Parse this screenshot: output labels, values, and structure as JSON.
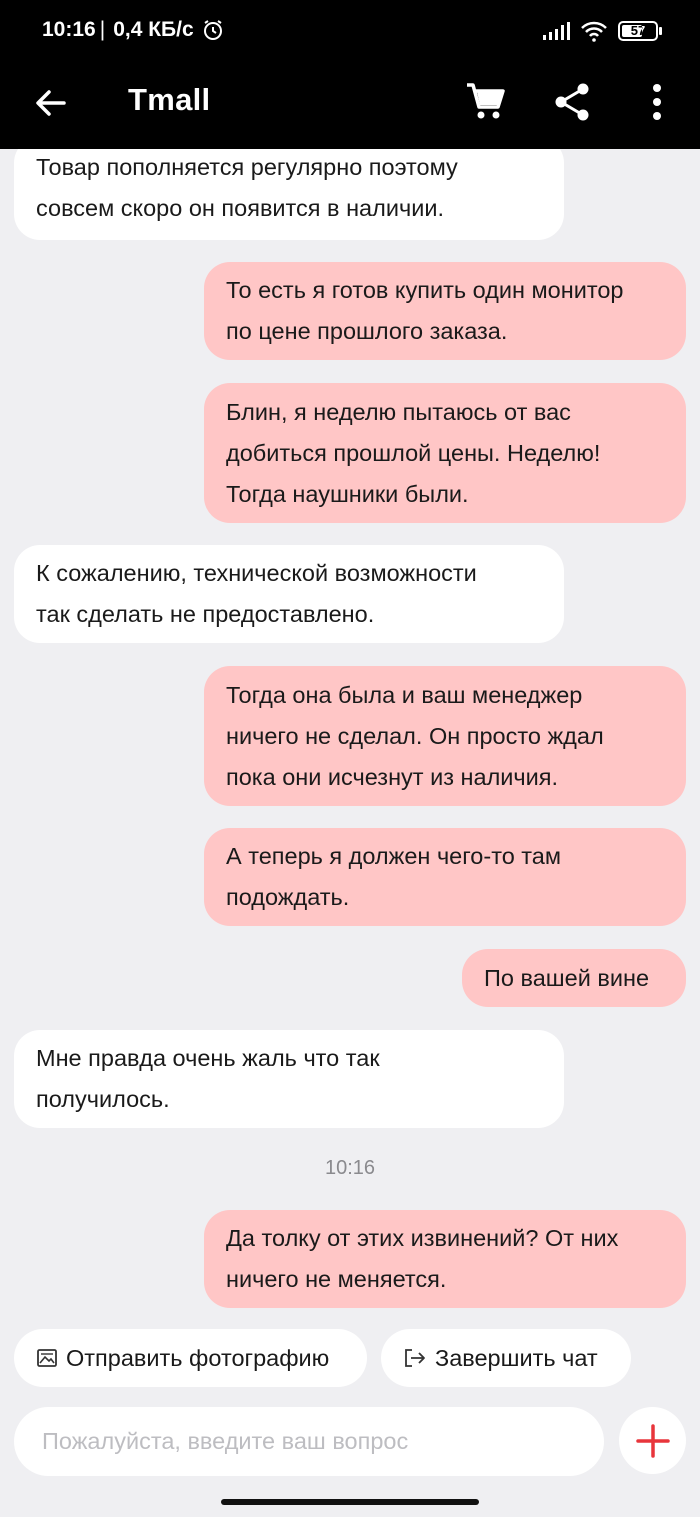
{
  "status_bar": {
    "time": "10:16",
    "separator": "|",
    "speed": "0,4 КБ/с",
    "battery": "57"
  },
  "app_bar": {
    "title": "Tmall"
  },
  "messages": [
    {
      "side": "in",
      "text": "Товар пополняется регулярно поэтому\nсовсем скоро он появится в наличии."
    },
    {
      "side": "out",
      "text": "То есть я готов купить один монитор\nпо цене прошлого заказа."
    },
    {
      "side": "out",
      "text": "Блин, я неделю пытаюсь от вас\nдобиться прошлой цены. Неделю!\nТогда наушники были."
    },
    {
      "side": "in",
      "text": "К сожалению, технической возможности\nтак сделать не предоставлено."
    },
    {
      "side": "out",
      "text": "Тогда она была и ваш менеджер\nничего не сделал. Он просто ждал\nпока они исчезнут из наличия."
    },
    {
      "side": "out",
      "text": "А теперь я должен чего-то там\nподождать."
    },
    {
      "side": "out",
      "text": "По вашей вине"
    },
    {
      "side": "in",
      "text": "Мне правда очень жаль что так\nполучилось."
    },
    {
      "side": "out",
      "text": "Да толку от этих извинений? От них\nничего не меняется."
    }
  ],
  "time_separator": "10:16",
  "actions": {
    "send_photo": "Отправить фотографию",
    "end_chat": "Завершить чат"
  },
  "input": {
    "placeholder": "Пожалуйста, введите ваш вопрос",
    "value": ""
  },
  "colors": {
    "incoming_bubble": "#ffffff",
    "outgoing_bubble": "#ffc6c6",
    "accent": "#e8353b",
    "background": "#efeff2"
  }
}
